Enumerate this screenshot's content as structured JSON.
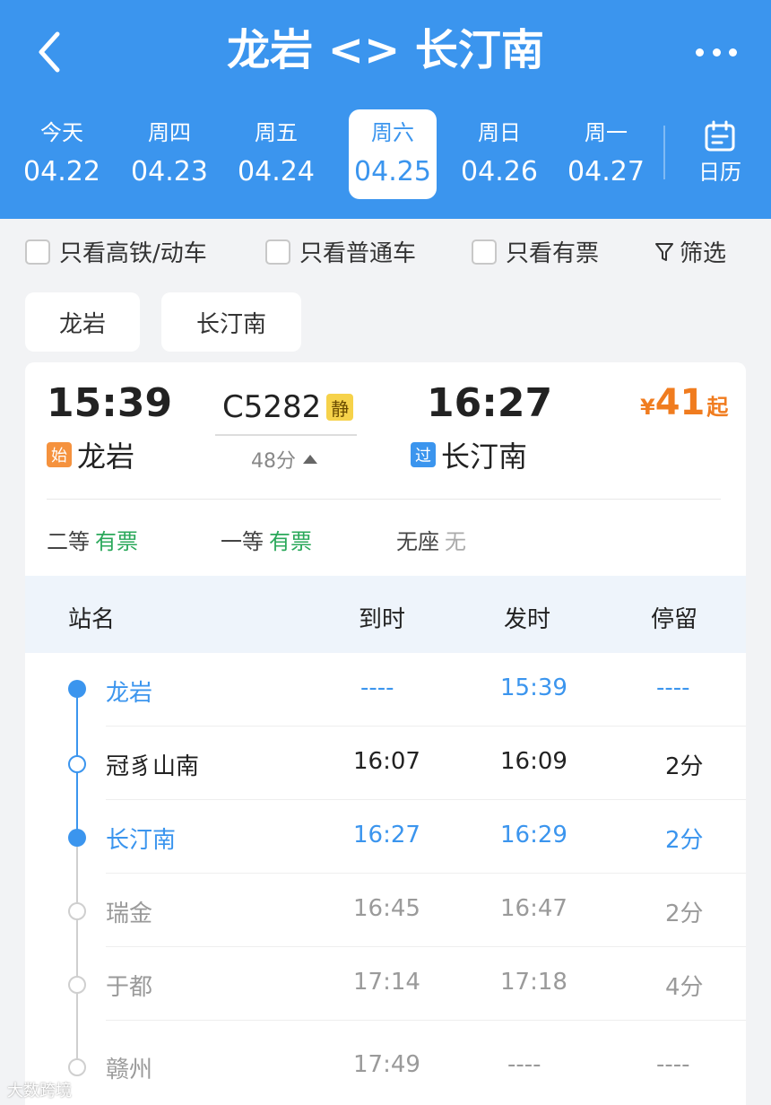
{
  "header": {
    "title": "龙岩 <> 长汀南",
    "dates": [
      {
        "dow": "今天",
        "date": "04.22"
      },
      {
        "dow": "周四",
        "date": "04.23"
      },
      {
        "dow": "周五",
        "date": "04.24"
      },
      {
        "dow": "周六",
        "date": "04.25"
      },
      {
        "dow": "周日",
        "date": "04.26"
      },
      {
        "dow": "周一",
        "date": "04.27"
      }
    ],
    "calendar_label": "日历"
  },
  "filters": {
    "high_speed": "只看高铁/动车",
    "normal": "只看普通车",
    "available": "只看有票",
    "filter": "筛选"
  },
  "chips": {
    "from": "龙岩",
    "to": "长汀南"
  },
  "train": {
    "depart_time": "15:39",
    "depart_tag": "始",
    "depart_station": "龙岩",
    "number": "C5282",
    "quiet_badge": "静",
    "duration": "48分",
    "arrive_time": "16:27",
    "arrive_tag": "过",
    "arrive_station": "长汀南",
    "price_symbol": "¥",
    "price": "41",
    "price_suffix": "起",
    "seats": [
      {
        "class": "二等",
        "status": "有票"
      },
      {
        "class": "一等",
        "status": "有票"
      },
      {
        "class": "无座",
        "status": "无"
      }
    ]
  },
  "table": {
    "headers": {
      "station": "站名",
      "arrive": "到时",
      "depart": "发时",
      "stay": "停留"
    },
    "rows": [
      {
        "station": "龙岩",
        "arrive": "----",
        "depart": "15:39",
        "stay": "----"
      },
      {
        "station": "冠豸山南",
        "arrive": "16:07",
        "depart": "16:09",
        "stay": "2分"
      },
      {
        "station": "长汀南",
        "arrive": "16:27",
        "depart": "16:29",
        "stay": "2分"
      },
      {
        "station": "瑞金",
        "arrive": "16:45",
        "depart": "16:47",
        "stay": "2分"
      },
      {
        "station": "于都",
        "arrive": "17:14",
        "depart": "17:18",
        "stay": "4分"
      },
      {
        "station": "赣州",
        "arrive": "17:49",
        "depart": "----",
        "stay": "----"
      }
    ]
  },
  "watermark": "大数跨境",
  "colors": {
    "primary": "#3b95ee",
    "price": "#f07c1f",
    "available": "#2aa85a",
    "inactive": "#9a9a9a"
  }
}
